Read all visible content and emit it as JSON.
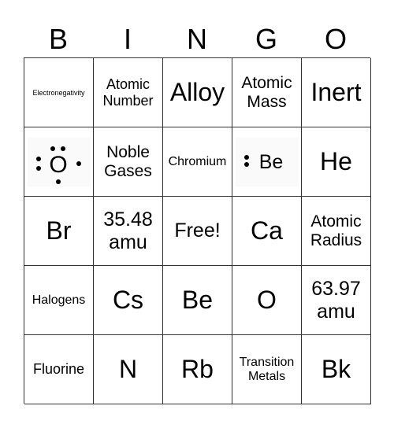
{
  "header": [
    "B",
    "I",
    "N",
    "G",
    "O"
  ],
  "cells": [
    {
      "text": "Electronegativity",
      "size": "s9"
    },
    {
      "text": "Atomic Number",
      "size": "s18"
    },
    {
      "text": "Alloy",
      "size": "s30"
    },
    {
      "text": "Atomic Mass",
      "size": "s20"
    },
    {
      "text": "Inert",
      "size": "s30"
    },
    {
      "text": "O",
      "image": "lewis-oxygen"
    },
    {
      "text": "Noble Gases",
      "size": "s20"
    },
    {
      "text": "Chromium",
      "size": "s16"
    },
    {
      "text": "Be",
      "image": "lewis-beryllium"
    },
    {
      "text": "He",
      "size": "s30"
    },
    {
      "text": "Br",
      "size": "s30"
    },
    {
      "text": "35.48 amu",
      "size": "s24"
    },
    {
      "text": "Free!",
      "size": "s24"
    },
    {
      "text": "Ca",
      "size": "s30"
    },
    {
      "text": "Atomic Radius",
      "size": "s20"
    },
    {
      "text": "Halogens",
      "size": "s16"
    },
    {
      "text": "Cs",
      "size": "s30"
    },
    {
      "text": "Be",
      "size": "s30"
    },
    {
      "text": "O",
      "size": "s30"
    },
    {
      "text": "63.97 amu",
      "size": "s24"
    },
    {
      "text": "Fluorine",
      "size": "s18"
    },
    {
      "text": "N",
      "size": "s30"
    },
    {
      "text": "Rb",
      "size": "s30"
    },
    {
      "text": "Transition Metals",
      "size": "s16"
    },
    {
      "text": "Bk",
      "size": "s30"
    }
  ]
}
